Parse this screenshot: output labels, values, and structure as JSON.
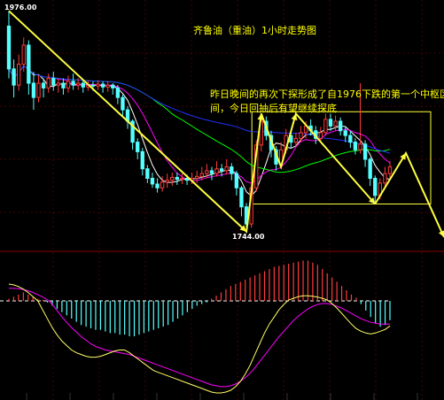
{
  "chart_data": {
    "type": "candlestick",
    "title": "齐鲁油（重油）1小时走势图",
    "annotation_line1": "昨日晚间的再次下探形成了自1976下跌的第一个中枢区",
    "annotation_line2": "间，今日回抽后有望继续探底",
    "high_label": "1976.00",
    "low_label": "1744.00",
    "high_value": 1976,
    "low_value": 1744,
    "price_range": [
      1740,
      1980
    ],
    "pivot_zone": {
      "from": 1773,
      "to": 1870
    },
    "x_tick_labels": [
      "",
      "",
      "",
      "",
      "",
      "",
      "",
      "",
      "",
      "",
      ""
    ],
    "candles": [
      {
        "o": 1960,
        "c": 1915,
        "h": 1976,
        "l": 1905
      },
      {
        "o": 1915,
        "c": 1898,
        "h": 1925,
        "l": 1885
      },
      {
        "o": 1898,
        "c": 1920,
        "h": 1930,
        "l": 1892
      },
      {
        "o": 1920,
        "c": 1940,
        "h": 1948,
        "l": 1912
      },
      {
        "o": 1940,
        "c": 1900,
        "h": 1945,
        "l": 1888
      },
      {
        "o": 1900,
        "c": 1885,
        "h": 1912,
        "l": 1872
      },
      {
        "o": 1885,
        "c": 1900,
        "h": 1908,
        "l": 1880
      },
      {
        "o": 1900,
        "c": 1895,
        "h": 1905,
        "l": 1885
      },
      {
        "o": 1895,
        "c": 1905,
        "h": 1910,
        "l": 1890
      },
      {
        "o": 1905,
        "c": 1898,
        "h": 1912,
        "l": 1892
      },
      {
        "o": 1898,
        "c": 1900,
        "h": 1905,
        "l": 1890
      },
      {
        "o": 1900,
        "c": 1895,
        "h": 1905,
        "l": 1888
      },
      {
        "o": 1895,
        "c": 1902,
        "h": 1908,
        "l": 1890
      },
      {
        "o": 1902,
        "c": 1898,
        "h": 1910,
        "l": 1893
      },
      {
        "o": 1898,
        "c": 1900,
        "h": 1905,
        "l": 1893
      },
      {
        "o": 1900,
        "c": 1896,
        "h": 1904,
        "l": 1890
      },
      {
        "o": 1896,
        "c": 1898,
        "h": 1903,
        "l": 1892
      },
      {
        "o": 1898,
        "c": 1897,
        "h": 1902,
        "l": 1892
      },
      {
        "o": 1897,
        "c": 1899,
        "h": 1903,
        "l": 1893
      },
      {
        "o": 1899,
        "c": 1896,
        "h": 1902,
        "l": 1890
      },
      {
        "o": 1896,
        "c": 1898,
        "h": 1902,
        "l": 1891
      },
      {
        "o": 1898,
        "c": 1895,
        "h": 1900,
        "l": 1888
      },
      {
        "o": 1895,
        "c": 1885,
        "h": 1898,
        "l": 1878
      },
      {
        "o": 1885,
        "c": 1872,
        "h": 1888,
        "l": 1865
      },
      {
        "o": 1872,
        "c": 1860,
        "h": 1876,
        "l": 1852
      },
      {
        "o": 1860,
        "c": 1838,
        "h": 1862,
        "l": 1830
      },
      {
        "o": 1838,
        "c": 1828,
        "h": 1842,
        "l": 1820
      },
      {
        "o": 1828,
        "c": 1810,
        "h": 1832,
        "l": 1803
      },
      {
        "o": 1810,
        "c": 1800,
        "h": 1814,
        "l": 1795
      },
      {
        "o": 1800,
        "c": 1794,
        "h": 1806,
        "l": 1790
      },
      {
        "o": 1794,
        "c": 1790,
        "h": 1800,
        "l": 1785
      },
      {
        "o": 1790,
        "c": 1796,
        "h": 1802,
        "l": 1786
      },
      {
        "o": 1796,
        "c": 1798,
        "h": 1805,
        "l": 1790
      },
      {
        "o": 1798,
        "c": 1801,
        "h": 1806,
        "l": 1792
      },
      {
        "o": 1801,
        "c": 1799,
        "h": 1806,
        "l": 1793
      },
      {
        "o": 1799,
        "c": 1800,
        "h": 1805,
        "l": 1794
      },
      {
        "o": 1800,
        "c": 1798,
        "h": 1804,
        "l": 1793
      },
      {
        "o": 1798,
        "c": 1800,
        "h": 1806,
        "l": 1794
      },
      {
        "o": 1800,
        "c": 1802,
        "h": 1808,
        "l": 1795
      },
      {
        "o": 1802,
        "c": 1805,
        "h": 1812,
        "l": 1798
      },
      {
        "o": 1805,
        "c": 1808,
        "h": 1815,
        "l": 1800
      },
      {
        "o": 1808,
        "c": 1805,
        "h": 1812,
        "l": 1798
      },
      {
        "o": 1805,
        "c": 1810,
        "h": 1818,
        "l": 1802
      },
      {
        "o": 1810,
        "c": 1808,
        "h": 1815,
        "l": 1802
      },
      {
        "o": 1808,
        "c": 1812,
        "h": 1820,
        "l": 1804
      },
      {
        "o": 1812,
        "c": 1805,
        "h": 1816,
        "l": 1798
      },
      {
        "o": 1805,
        "c": 1790,
        "h": 1808,
        "l": 1782
      },
      {
        "o": 1790,
        "c": 1770,
        "h": 1792,
        "l": 1760
      },
      {
        "o": 1770,
        "c": 1752,
        "h": 1774,
        "l": 1744
      },
      {
        "o": 1752,
        "c": 1790,
        "h": 1795,
        "l": 1748
      },
      {
        "o": 1790,
        "c": 1835,
        "h": 1840,
        "l": 1786
      },
      {
        "o": 1835,
        "c": 1860,
        "h": 1868,
        "l": 1828
      },
      {
        "o": 1860,
        "c": 1845,
        "h": 1865,
        "l": 1840
      },
      {
        "o": 1845,
        "c": 1830,
        "h": 1850,
        "l": 1822
      },
      {
        "o": 1830,
        "c": 1815,
        "h": 1834,
        "l": 1808
      },
      {
        "o": 1815,
        "c": 1830,
        "h": 1838,
        "l": 1810
      },
      {
        "o": 1830,
        "c": 1845,
        "h": 1852,
        "l": 1826
      },
      {
        "o": 1845,
        "c": 1838,
        "h": 1850,
        "l": 1832
      },
      {
        "o": 1838,
        "c": 1842,
        "h": 1848,
        "l": 1834
      },
      {
        "o": 1842,
        "c": 1848,
        "h": 1855,
        "l": 1838
      },
      {
        "o": 1848,
        "c": 1855,
        "h": 1860,
        "l": 1842
      },
      {
        "o": 1855,
        "c": 1850,
        "h": 1862,
        "l": 1845
      },
      {
        "o": 1850,
        "c": 1842,
        "h": 1855,
        "l": 1836
      },
      {
        "o": 1842,
        "c": 1848,
        "h": 1854,
        "l": 1838
      },
      {
        "o": 1848,
        "c": 1862,
        "h": 1868,
        "l": 1845
      },
      {
        "o": 1862,
        "c": 1855,
        "h": 1868,
        "l": 1850
      },
      {
        "o": 1855,
        "c": 1860,
        "h": 1866,
        "l": 1850
      },
      {
        "o": 1860,
        "c": 1850,
        "h": 1864,
        "l": 1845
      },
      {
        "o": 1850,
        "c": 1845,
        "h": 1855,
        "l": 1838
      },
      {
        "o": 1845,
        "c": 1838,
        "h": 1850,
        "l": 1832
      },
      {
        "o": 1838,
        "c": 1830,
        "h": 1842,
        "l": 1825
      },
      {
        "o": 1830,
        "c": 1836,
        "h": 1900,
        "l": 1826
      },
      {
        "o": 1836,
        "c": 1820,
        "h": 1840,
        "l": 1812
      },
      {
        "o": 1820,
        "c": 1800,
        "h": 1822,
        "l": 1792
      },
      {
        "o": 1800,
        "c": 1782,
        "h": 1803,
        "l": 1773
      },
      {
        "o": 1782,
        "c": 1795,
        "h": 1800,
        "l": 1778
      },
      {
        "o": 1795,
        "c": 1805,
        "h": 1812,
        "l": 1790
      },
      {
        "o": 1805,
        "c": 1812,
        "h": 1818,
        "l": 1800
      }
    ],
    "macd_hist": [
      2,
      4,
      6,
      8,
      6,
      4,
      2,
      1,
      -1,
      -3,
      -5,
      -7,
      -9,
      -11,
      -13,
      -15,
      -16,
      -17,
      -18,
      -18,
      -19,
      -20,
      -20,
      -21,
      -21,
      -22,
      -22,
      -21,
      -20,
      -19,
      -18,
      -17,
      -16,
      -15,
      -13,
      -11,
      -9,
      -7,
      -5,
      -3,
      -2,
      -1,
      2,
      5,
      8,
      11,
      14,
      16,
      18,
      20,
      22,
      24,
      26,
      28,
      30,
      32,
      33,
      34,
      35,
      36,
      37,
      38,
      38,
      36,
      34,
      30,
      26,
      22,
      18,
      14,
      10,
      6,
      3,
      -2,
      -6,
      -10,
      -14,
      -16,
      -15,
      -12
    ],
    "macd_dif": [
      40,
      38,
      34,
      28,
      20,
      10,
      0,
      -10,
      -20,
      -30,
      -38,
      -45,
      -50,
      -55,
      -58,
      -60,
      -62,
      -63,
      -63,
      -62,
      -60,
      -58,
      -56,
      -55,
      -55,
      -58,
      -62,
      -66,
      -70,
      -74,
      -78,
      -80,
      -82,
      -84,
      -86,
      -88,
      -90,
      -92,
      -94,
      -96,
      -98,
      -100,
      -102,
      -103,
      -103,
      -102,
      -100,
      -96,
      -90,
      -82,
      -72,
      -60,
      -48,
      -36,
      -26,
      -18,
      -10,
      -4,
      2,
      6,
      10,
      12,
      12,
      11,
      9,
      6,
      2,
      -3,
      -8,
      -14,
      -20,
      -26,
      -31,
      -34,
      -36,
      -37,
      -36,
      -34,
      -32,
      -28
    ],
    "macd_dea": [
      30,
      30,
      29,
      27,
      24,
      20,
      15,
      9,
      3,
      -4,
      -11,
      -18,
      -24,
      -30,
      -35,
      -40,
      -44,
      -48,
      -51,
      -53,
      -55,
      -56,
      -57,
      -58,
      -59,
      -60,
      -62,
      -64,
      -66,
      -68,
      -70,
      -72,
      -74,
      -76,
      -78,
      -80,
      -82,
      -84,
      -86,
      -88,
      -90,
      -92,
      -94,
      -95,
      -96,
      -96,
      -95,
      -93,
      -90,
      -86,
      -81,
      -75,
      -68,
      -61,
      -54,
      -47,
      -40,
      -34,
      -28,
      -22,
      -17,
      -13,
      -9,
      -6,
      -4,
      -3,
      -3,
      -4,
      -6,
      -8,
      -11,
      -14,
      -17,
      -20,
      -22,
      -24,
      -25,
      -26,
      -26,
      -26
    ],
    "colors": {
      "background": "#000000",
      "up_candle": "#ff3c3c",
      "down_candle": "#54ffff",
      "trend_line": "#ffff40",
      "ma_short": "#ffffff",
      "ma_mid": "#ff00ff",
      "ma_long": "#00ff00",
      "ma_longest": "#2233ff",
      "macd_positive": "#ff3c3c",
      "macd_negative": "#54ffff",
      "dif": "#ffff66",
      "dea": "#ff00ff",
      "zero_line": "#ffffff",
      "grid": "#4a0000",
      "panel_border": "#880000"
    }
  }
}
